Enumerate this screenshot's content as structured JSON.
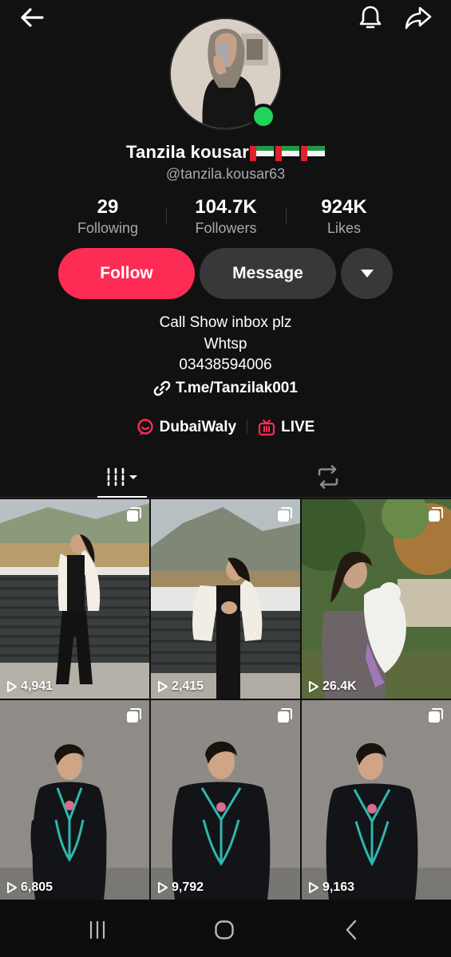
{
  "profile": {
    "display_name": "Tanzila kousar",
    "handle": "@tanzila.kousar63",
    "online": true
  },
  "stats": {
    "following": {
      "value": "29",
      "label": "Following"
    },
    "followers": {
      "value": "104.7K",
      "label": "Followers"
    },
    "likes": {
      "value": "924K",
      "label": "Likes"
    }
  },
  "actions": {
    "follow_label": "Follow",
    "message_label": "Message"
  },
  "bio": {
    "lines": [
      "Call Show inbox plz",
      "Whtsp",
      "03438594006"
    ],
    "link": "T.me/Tanzilak001"
  },
  "badges": {
    "community": "DubaiWaly",
    "live": "LIVE"
  },
  "videos": [
    {
      "plays": "4,941"
    },
    {
      "plays": "2,415"
    },
    {
      "plays": "26.4K"
    },
    {
      "plays": "6,805"
    },
    {
      "plays": "9,792"
    },
    {
      "plays": "9,163"
    }
  ],
  "colors": {
    "background": "#111112",
    "accent": "#fe2c55",
    "secondary_button": "#38383a",
    "online": "#20d35a",
    "muted_text": "#a9a9ad"
  },
  "icons": {
    "back": "arrow-left-icon",
    "notifications": "bell-icon",
    "share": "share-icon",
    "more": "caret-down-icon",
    "link": "link-icon",
    "community": "chat-bubble-icon",
    "live": "live-tv-icon",
    "videos_tab": "grid-icon",
    "reposts_tab": "repost-icon",
    "multi_video": "multi-square-icon",
    "plays": "play-icon"
  }
}
